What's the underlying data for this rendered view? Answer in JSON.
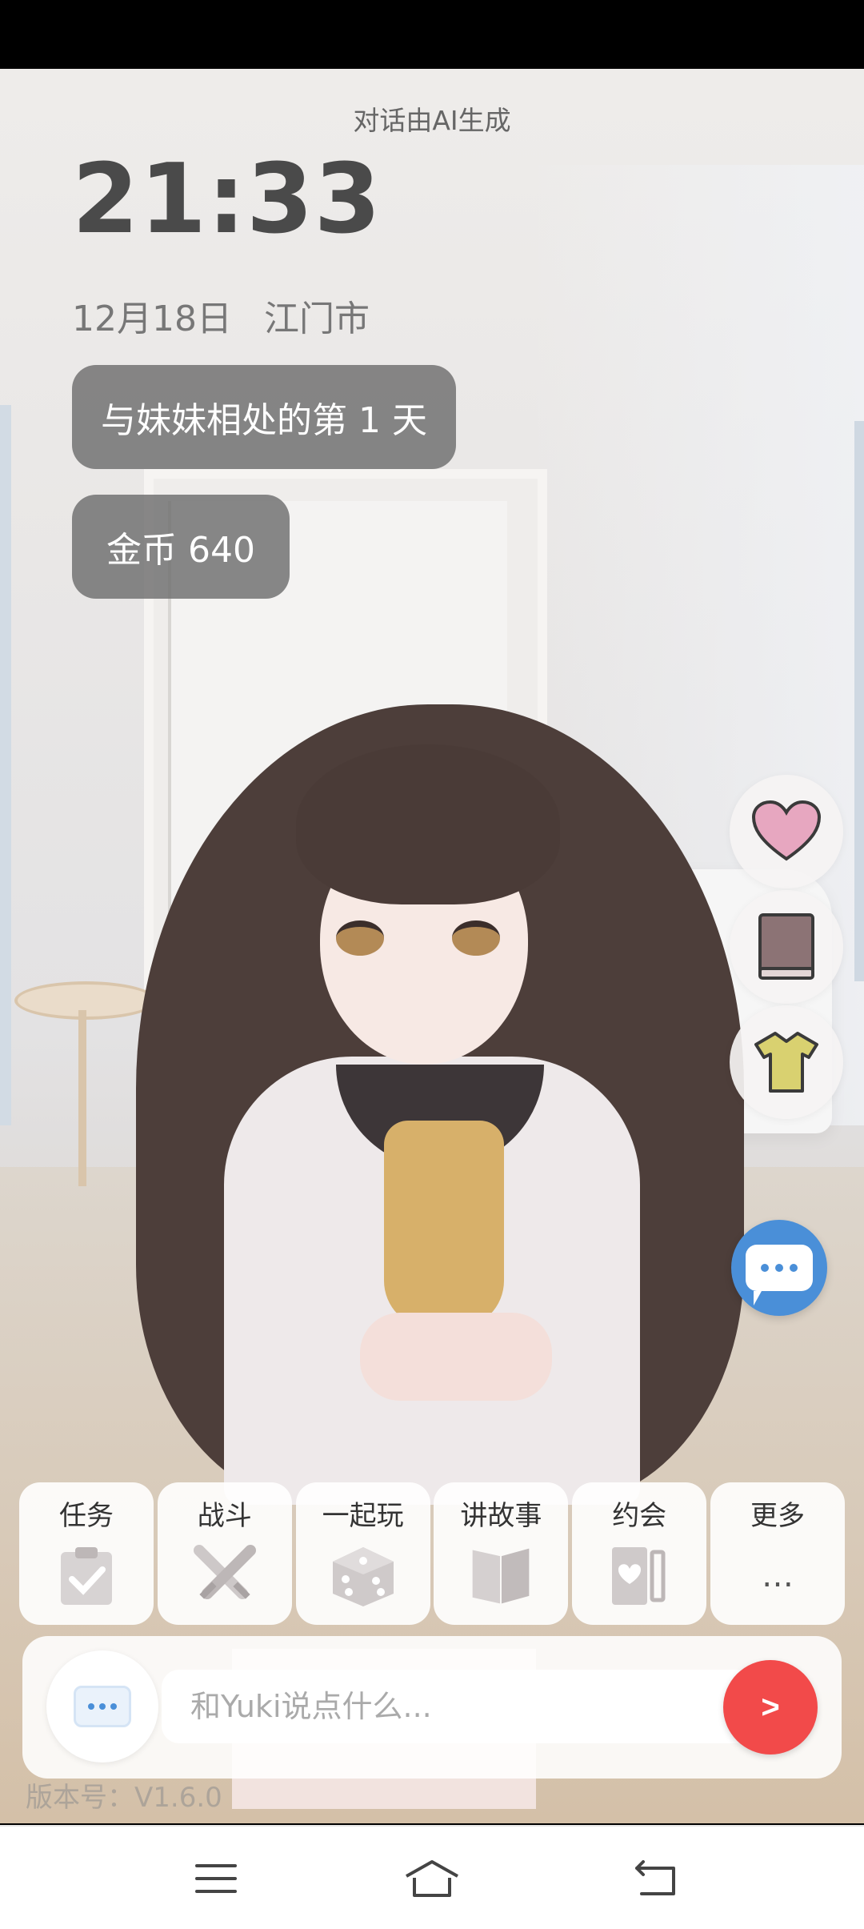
{
  "overlay": {
    "ai_notice": "对话由AI生成",
    "time": "21:33",
    "date": "12月18日",
    "city": "江门市",
    "days_badge": "与妹妹相处的第 1 天",
    "coins_badge": "金币 640",
    "version": "版本号：V1.6.0"
  },
  "side_buttons": [
    {
      "name": "favorability",
      "icon": "heart-icon"
    },
    {
      "name": "diary",
      "icon": "book-icon"
    },
    {
      "name": "wardrobe",
      "icon": "shirt-icon"
    }
  ],
  "actions": [
    {
      "label": "任务",
      "icon": "clipboard-check-icon"
    },
    {
      "label": "战斗",
      "icon": "crossed-swords-icon"
    },
    {
      "label": "一起玩",
      "icon": "dice-icon"
    },
    {
      "label": "讲故事",
      "icon": "open-book-icon"
    },
    {
      "label": "约会",
      "icon": "heart-card-icon"
    },
    {
      "label": "更多",
      "icon": "ellipsis-icon",
      "glyph": "…"
    }
  ],
  "chat": {
    "placeholder": "和Yuki说点什么...",
    "send_label": ">"
  },
  "colors": {
    "send": "#f24a4a",
    "chat_fab": "#4a8fd8",
    "badge_bg": "#6e6e6e",
    "heart": "#e7a7c0",
    "book": "#8c7375",
    "shirt": "#d9d170"
  },
  "nav": [
    "menu-icon",
    "home-icon",
    "back-icon"
  ]
}
